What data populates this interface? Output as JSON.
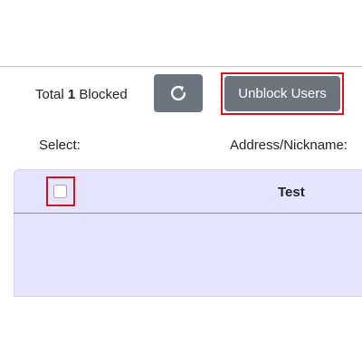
{
  "summary": {
    "prefix": "Total",
    "count": "1",
    "suffix": "Blocked"
  },
  "toolbar": {
    "refresh_icon": "refresh-icon",
    "unblock_label": "Unblock Users"
  },
  "columns": {
    "select": "Select:",
    "address": "Address/Nickname:"
  },
  "users": [
    {
      "name": "Test",
      "checked": false
    }
  ],
  "colors": {
    "button": "#6c757d",
    "panel": "#e6e4fe",
    "highlight": "#d0161b"
  }
}
